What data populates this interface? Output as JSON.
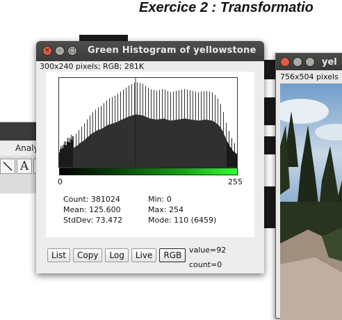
{
  "document": {
    "heading": "Exercice 2 : Transformatio"
  },
  "toolbar_window": {
    "menu_label": "Analy",
    "text_tool_glyph": "A"
  },
  "image_window": {
    "title": "yel",
    "info": "756x504 pixels"
  },
  "histogram_window": {
    "title": "Green Histogram of yellowstone",
    "info": "300x240 pixels; RGB; 281K",
    "axis_min": "0",
    "axis_max": "255",
    "stats": {
      "count": "Count: 381024",
      "min": "Min: 0",
      "mean": "Mean: 125.600",
      "max": "Max: 254",
      "stddev": "StdDev: 73.472",
      "mode": "Mode: 110 (6459)"
    },
    "buttons": {
      "list": "List",
      "copy": "Copy",
      "log": "Log",
      "live": "Live",
      "rgb": "RGB"
    },
    "value_readout": "value=92",
    "count_readout": "count=0",
    "colors": {
      "ramp_end": "#33ff33",
      "close": "#e15b3f"
    }
  },
  "chart_data": {
    "type": "bar",
    "x_range": [
      0,
      255
    ],
    "profile_x": [
      0,
      5,
      10,
      15,
      20,
      25,
      30,
      35,
      40,
      45,
      50,
      55,
      60,
      65,
      70,
      80,
      90,
      100,
      110,
      120,
      130,
      140,
      150,
      160,
      170,
      180,
      190,
      200,
      210,
      220,
      225,
      230,
      235,
      240,
      245,
      250,
      255
    ],
    "profile_level": [
      0.2,
      0.26,
      0.3,
      0.34,
      0.36,
      0.4,
      0.46,
      0.5,
      0.56,
      0.62,
      0.66,
      0.7,
      0.72,
      0.76,
      0.8,
      0.84,
      0.9,
      0.96,
      1.0,
      0.98,
      0.92,
      0.9,
      0.92,
      0.88,
      0.9,
      0.92,
      0.9,
      0.88,
      0.9,
      0.88,
      0.84,
      0.78,
      0.68,
      0.52,
      0.4,
      0.3,
      0.25
    ],
    "notes": "Green-channel histogram; bars at 256 intensity levels with a comb pattern, peak near mode 110"
  }
}
